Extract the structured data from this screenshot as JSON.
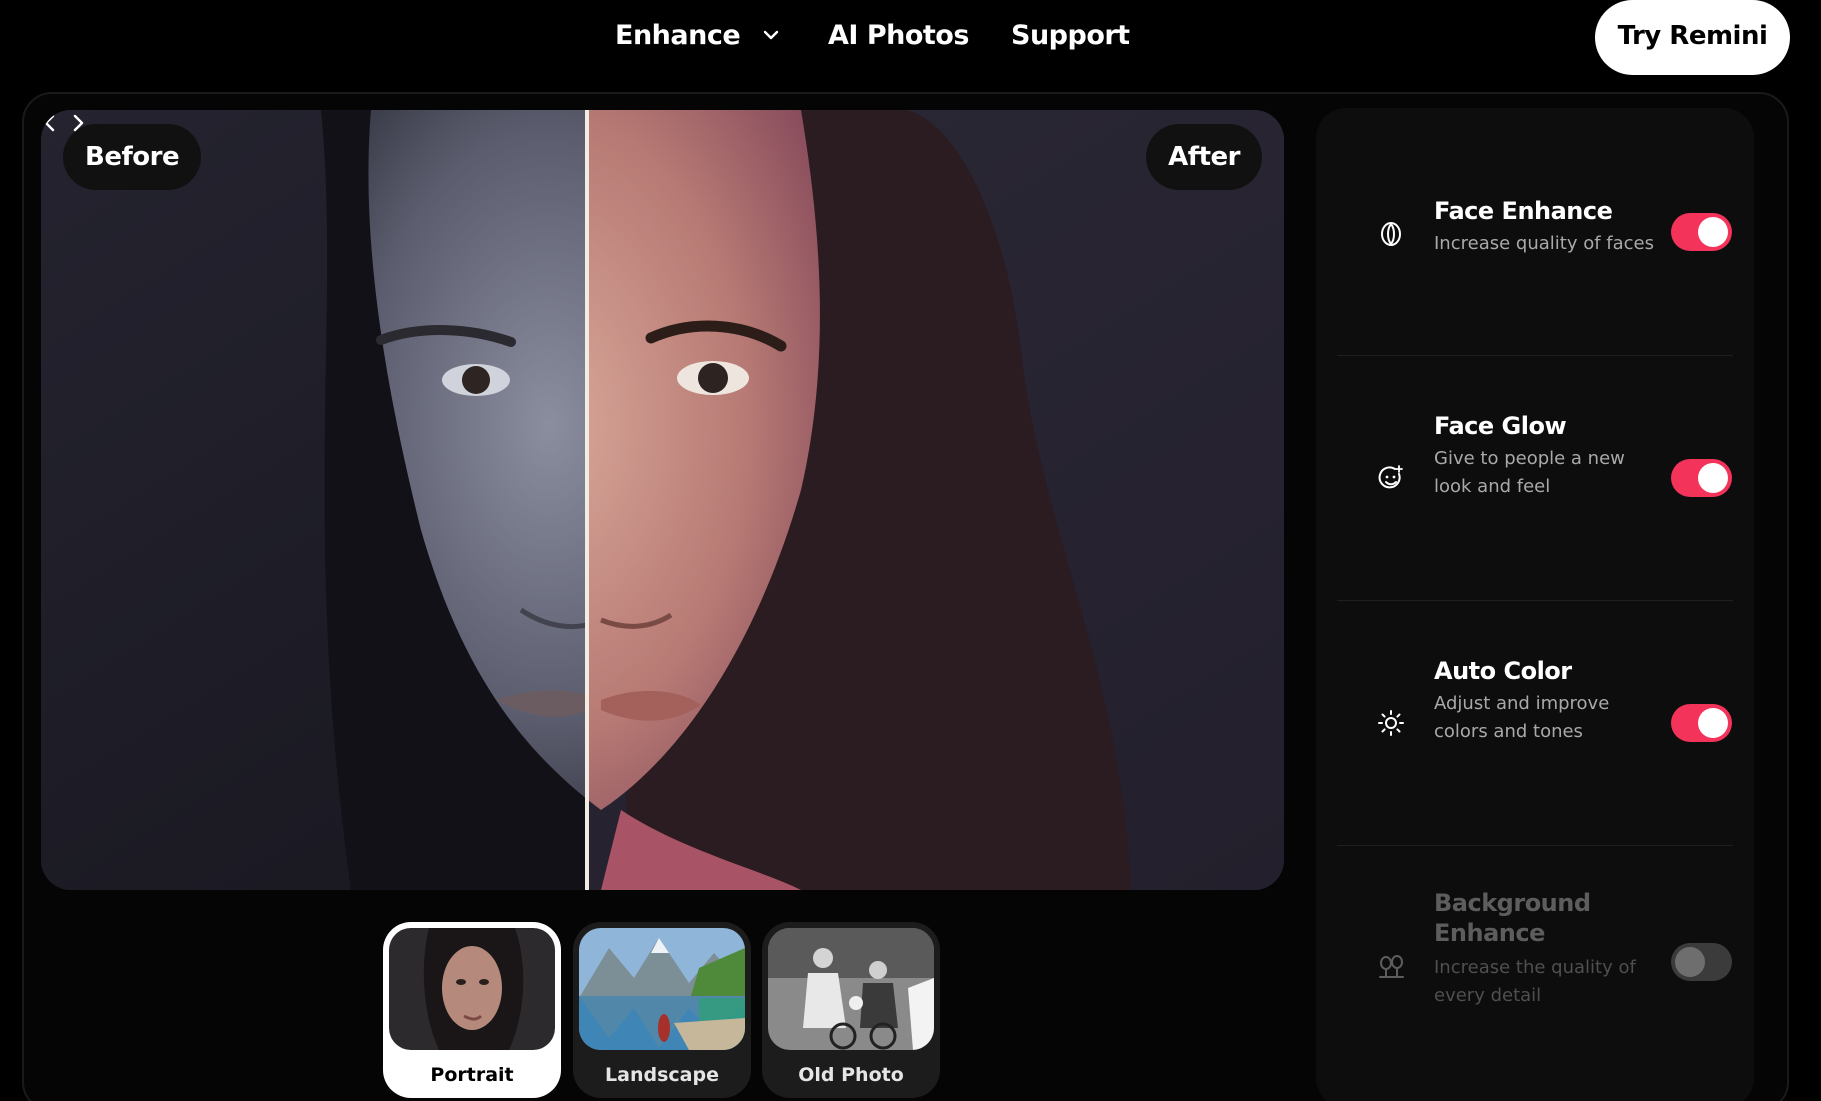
{
  "nav": {
    "items": [
      {
        "label": "Enhance"
      },
      {
        "label": "AI Photos"
      },
      {
        "label": "Support"
      }
    ],
    "cta_label": "Try Remini"
  },
  "viewer": {
    "before_label": "Before",
    "after_label": "After"
  },
  "thumbnails": [
    {
      "label": "Portrait",
      "selected": true
    },
    {
      "label": "Landscape",
      "selected": false
    },
    {
      "label": "Old Photo",
      "selected": false
    }
  ],
  "settings": [
    {
      "title": "Face Enhance",
      "description": "Increase quality of faces",
      "icon": "face-enhance-icon",
      "enabled": true
    },
    {
      "title": "Face Glow",
      "description": "Give to people a new look and feel",
      "icon": "face-glow-icon",
      "enabled": true
    },
    {
      "title": "Auto Color",
      "description": "Adjust and improve colors and tones",
      "icon": "sun-icon",
      "enabled": true
    },
    {
      "title": "Background Enhance",
      "description": "Increase the quality of every detail",
      "icon": "trees-icon",
      "enabled": false
    }
  ],
  "colors": {
    "accent": "#f4335a",
    "background": "#000000",
    "panel": "#0d0d0d"
  }
}
